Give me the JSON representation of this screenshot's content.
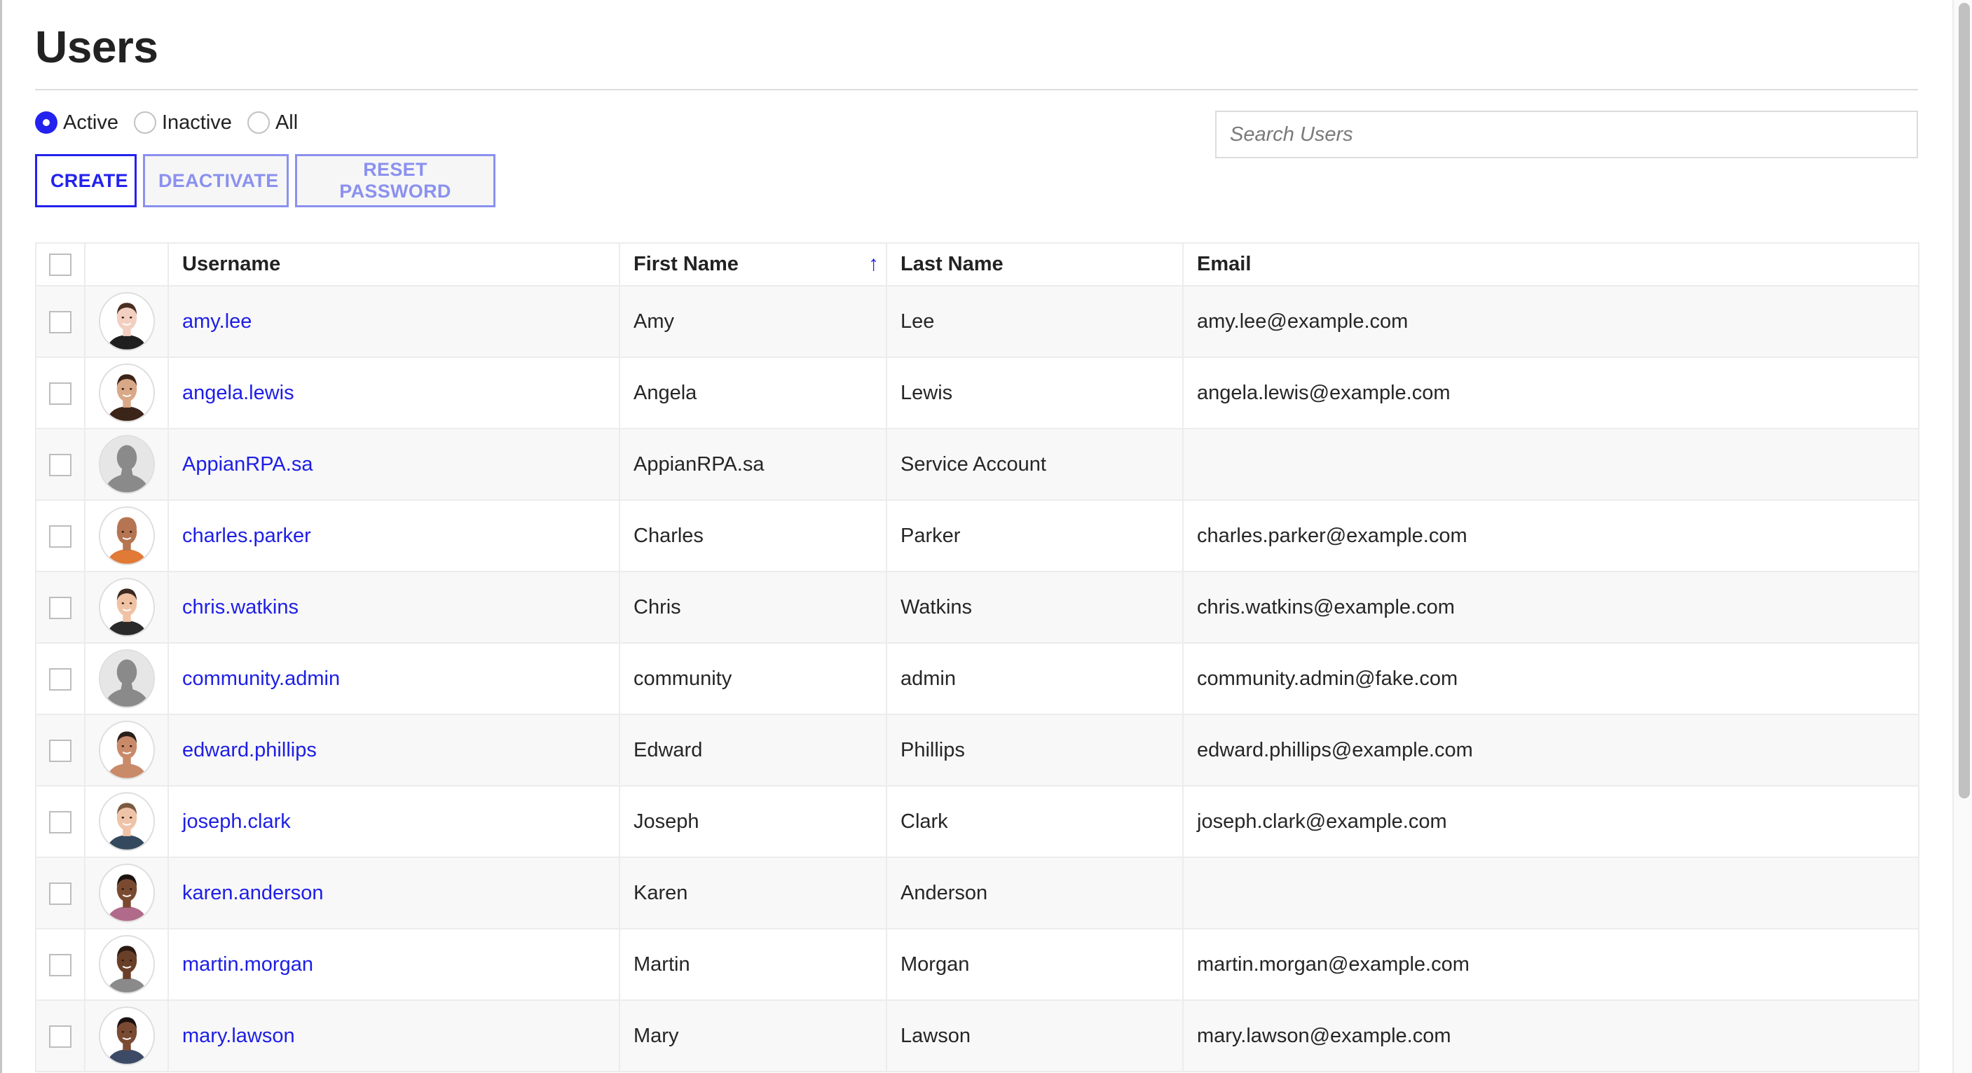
{
  "page": {
    "title": "Users"
  },
  "filter": {
    "options": [
      {
        "label": "Active",
        "selected": true
      },
      {
        "label": "Inactive",
        "selected": false
      },
      {
        "label": "All",
        "selected": false
      }
    ]
  },
  "toolbar": {
    "create_label": "CREATE",
    "deactivate_label": "DEACTIVATE",
    "reset_password_label": "RESET PASSWORD",
    "deactivate_enabled": false,
    "reset_password_enabled": false
  },
  "search": {
    "placeholder": "Search Users",
    "value": ""
  },
  "colors": {
    "accent": "#2322ee",
    "link": "#1e1ee6",
    "disabled": "#8b91ef"
  },
  "table": {
    "columns": [
      {
        "key": "select",
        "label": ""
      },
      {
        "key": "avatar",
        "label": ""
      },
      {
        "key": "username",
        "label": "Username"
      },
      {
        "key": "first_name",
        "label": "First Name",
        "sorted": "ascending"
      },
      {
        "key": "last_name",
        "label": "Last Name"
      },
      {
        "key": "email",
        "label": "Email"
      }
    ],
    "sort_icon": "arrow-up-icon",
    "rows": [
      {
        "username": "amy.lee",
        "first_name": "Amy",
        "last_name": "Lee",
        "email": "amy.lee@example.com",
        "avatar": {
          "type": "photo",
          "skin": "#f2cfc0",
          "hair": "#4a2e22",
          "clothes": "#1f1f1f"
        }
      },
      {
        "username": "angela.lewis",
        "first_name": "Angela",
        "last_name": "Lewis",
        "email": "angela.lewis@example.com",
        "avatar": {
          "type": "photo",
          "skin": "#d9a887",
          "hair": "#3b2418",
          "clothes": "#3b2418"
        }
      },
      {
        "username": "AppianRPA.sa",
        "first_name": "AppianRPA.sa",
        "last_name": "Service Account",
        "email": "",
        "avatar": {
          "type": "default"
        }
      },
      {
        "username": "charles.parker",
        "first_name": "Charles",
        "last_name": "Parker",
        "email": "charles.parker@example.com",
        "avatar": {
          "type": "photo",
          "skin": "#b57552",
          "hair": "#b57552",
          "clothes": "#e07a36"
        }
      },
      {
        "username": "chris.watkins",
        "first_name": "Chris",
        "last_name": "Watkins",
        "email": "chris.watkins@example.com",
        "avatar": {
          "type": "photo",
          "skin": "#f0c2a4",
          "hair": "#3a2a20",
          "clothes": "#2a2a2a"
        }
      },
      {
        "username": "community.admin",
        "first_name": "community",
        "last_name": "admin",
        "email": "community.admin@fake.com",
        "avatar": {
          "type": "default"
        }
      },
      {
        "username": "edward.phillips",
        "first_name": "Edward",
        "last_name": "Phillips",
        "email": "edward.phillips@example.com",
        "avatar": {
          "type": "photo",
          "skin": "#c98a6a",
          "hair": "#2a1e18",
          "clothes": "#c98a6a"
        }
      },
      {
        "username": "joseph.clark",
        "first_name": "Joseph",
        "last_name": "Clark",
        "email": "joseph.clark@example.com",
        "avatar": {
          "type": "photo",
          "skin": "#efc3a8",
          "hair": "#7a5a40",
          "clothes": "#34495e"
        }
      },
      {
        "username": "karen.anderson",
        "first_name": "Karen",
        "last_name": "Anderson",
        "email": "",
        "avatar": {
          "type": "photo",
          "skin": "#7a4a30",
          "hair": "#1a1410",
          "clothes": "#b06a8a"
        }
      },
      {
        "username": "martin.morgan",
        "first_name": "Martin",
        "last_name": "Morgan",
        "email": "martin.morgan@example.com",
        "avatar": {
          "type": "photo",
          "skin": "#6a3f28",
          "hair": "#2a1a12",
          "clothes": "#8a8a8a"
        }
      },
      {
        "username": "mary.lawson",
        "first_name": "Mary",
        "last_name": "Lawson",
        "email": "mary.lawson@example.com",
        "avatar": {
          "type": "photo",
          "skin": "#7a4a32",
          "hair": "#1a1210",
          "clothes": "#3c4a66"
        }
      }
    ]
  },
  "scrollbar": {
    "position": 0,
    "visible_fraction": 0.74
  }
}
